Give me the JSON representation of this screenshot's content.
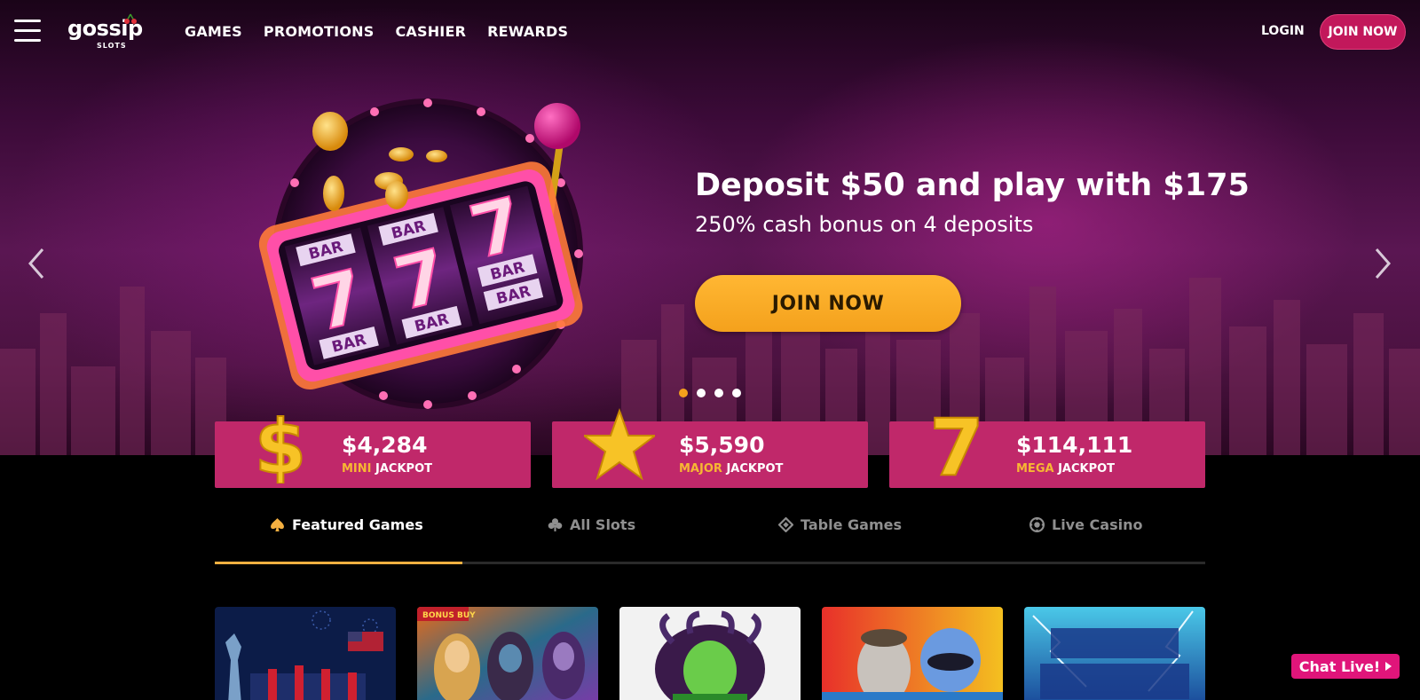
{
  "header": {
    "logo_text": "gossip",
    "logo_sub": "SLOTS",
    "nav": [
      "GAMES",
      "PROMOTIONS",
      "CASHIER",
      "REWARDS"
    ],
    "login_label": "LOGIN",
    "join_label": "JOIN NOW"
  },
  "hero": {
    "title": "Deposit $50 and play with $175",
    "subtitle": "250% cash bonus on 4 deposits",
    "cta_label": "JOIN NOW",
    "slide_count": 4,
    "active_slide": 1,
    "slot_labels": [
      "BAR",
      "7",
      "BAR"
    ]
  },
  "jackpots": [
    {
      "amount": "$4,284",
      "level": "MINI",
      "suffix": "JACKPOT",
      "icon": "dollar-icon"
    },
    {
      "amount": "$5,590",
      "level": "MAJOR",
      "suffix": "JACKPOT",
      "icon": "star-icon"
    },
    {
      "amount": "$114,111",
      "level": "MEGA",
      "suffix": "JACKPOT",
      "icon": "seven-icon"
    }
  ],
  "tabs": [
    {
      "label": "Featured Games",
      "icon": "spade-icon",
      "active": true
    },
    {
      "label": "All Slots",
      "icon": "club-icon",
      "active": false
    },
    {
      "label": "Table Games",
      "icon": "diamond-icon",
      "active": false
    },
    {
      "label": "Live Casino",
      "icon": "chip-icon",
      "active": false
    }
  ],
  "games": [
    {
      "badge": ""
    },
    {
      "badge": "BONUS BUY"
    },
    {
      "badge": ""
    },
    {
      "badge": ""
    },
    {
      "badge": ""
    }
  ],
  "chat": {
    "label": "Chat Live!"
  },
  "colors": {
    "accent_gold": "#f4a11c",
    "jackpot_bg": "#c0286a",
    "join_btn": "#c2185b",
    "chat_btn": "#e0157a"
  }
}
